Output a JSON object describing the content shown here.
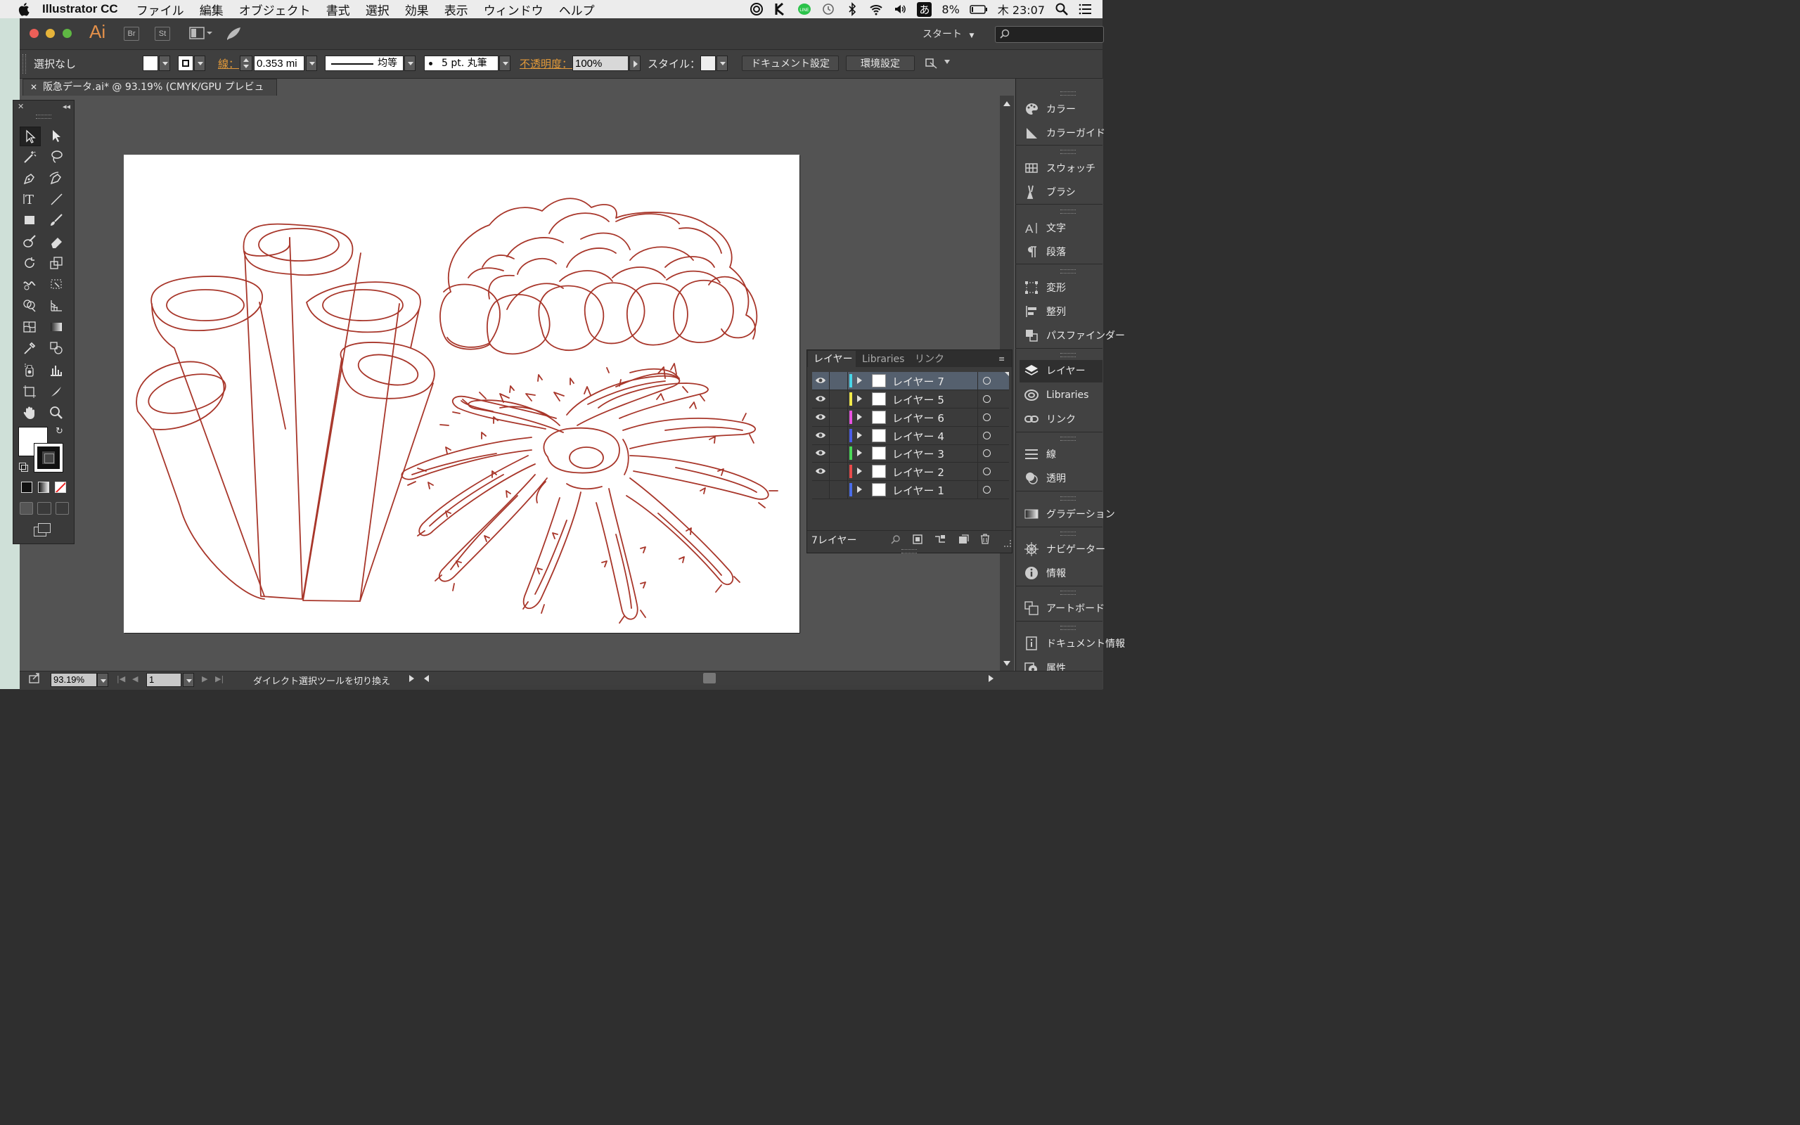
{
  "menubar": {
    "app_name": "Illustrator CC",
    "items": [
      "ファイル",
      "編集",
      "オブジェクト",
      "書式",
      "選択",
      "効果",
      "表示",
      "ウィンドウ",
      "ヘルプ"
    ],
    "battery": "8%",
    "clock": "木 23:07",
    "ime": "あ",
    "line_badge": "LINE"
  },
  "titlebar": {
    "app_logo": "Ai",
    "bridge_label": "Br",
    "stock_label": "St",
    "workspace_label": "スタート"
  },
  "control_bar": {
    "selection_status": "選択なし",
    "stroke_label": "線：",
    "stroke_value": "0.353 mi",
    "stroke_profile": "均等",
    "brush_value": "5 pt. 丸筆",
    "opacity_label": "不透明度：",
    "opacity_value": "100%",
    "style_label": "スタイル：",
    "document_setup_button": "ドキュメント設定",
    "preferences_button": "環境設定"
  },
  "document": {
    "tab_title": "阪急データ.ai* @ 93.19% (CMYK/GPU プレビュー)",
    "line_color": "#a8362a"
  },
  "dock": {
    "items": [
      "カラー",
      "カラーガイド",
      "スウォッチ",
      "ブラシ",
      "文字",
      "段落",
      "変形",
      "整列",
      "パスファインダー",
      "レイヤー",
      "Libraries",
      "リンク",
      "線",
      "透明",
      "グラデーション",
      "ナビゲーター",
      "情報",
      "アートボード",
      "ドキュメント情報",
      "属性"
    ]
  },
  "layers_panel": {
    "tabs": [
      "レイヤー",
      "Libraries",
      "リンク"
    ],
    "layers": [
      {
        "name": "レイヤー 7",
        "color": "#48d6e8",
        "visible": true,
        "selected": true
      },
      {
        "name": "レイヤー 5",
        "color": "#f2ea4a",
        "visible": true,
        "selected": false
      },
      {
        "name": "レイヤー 6",
        "color": "#e852e0",
        "visible": true,
        "selected": false
      },
      {
        "name": "レイヤー 4",
        "color": "#4a5ce8",
        "visible": true,
        "selected": false
      },
      {
        "name": "レイヤー 3",
        "color": "#4ad858",
        "visible": true,
        "selected": false
      },
      {
        "name": "レイヤー 2",
        "color": "#e84a4a",
        "visible": true,
        "selected": false
      },
      {
        "name": "レイヤー 1",
        "color": "#4a6ce8",
        "visible": false,
        "selected": false
      }
    ],
    "count_label": "7レイヤー"
  },
  "status_bar": {
    "zoom_value": "93.19%",
    "artboard_value": "1",
    "tool_hint": "ダイレクト選択ツールを切り換え"
  }
}
